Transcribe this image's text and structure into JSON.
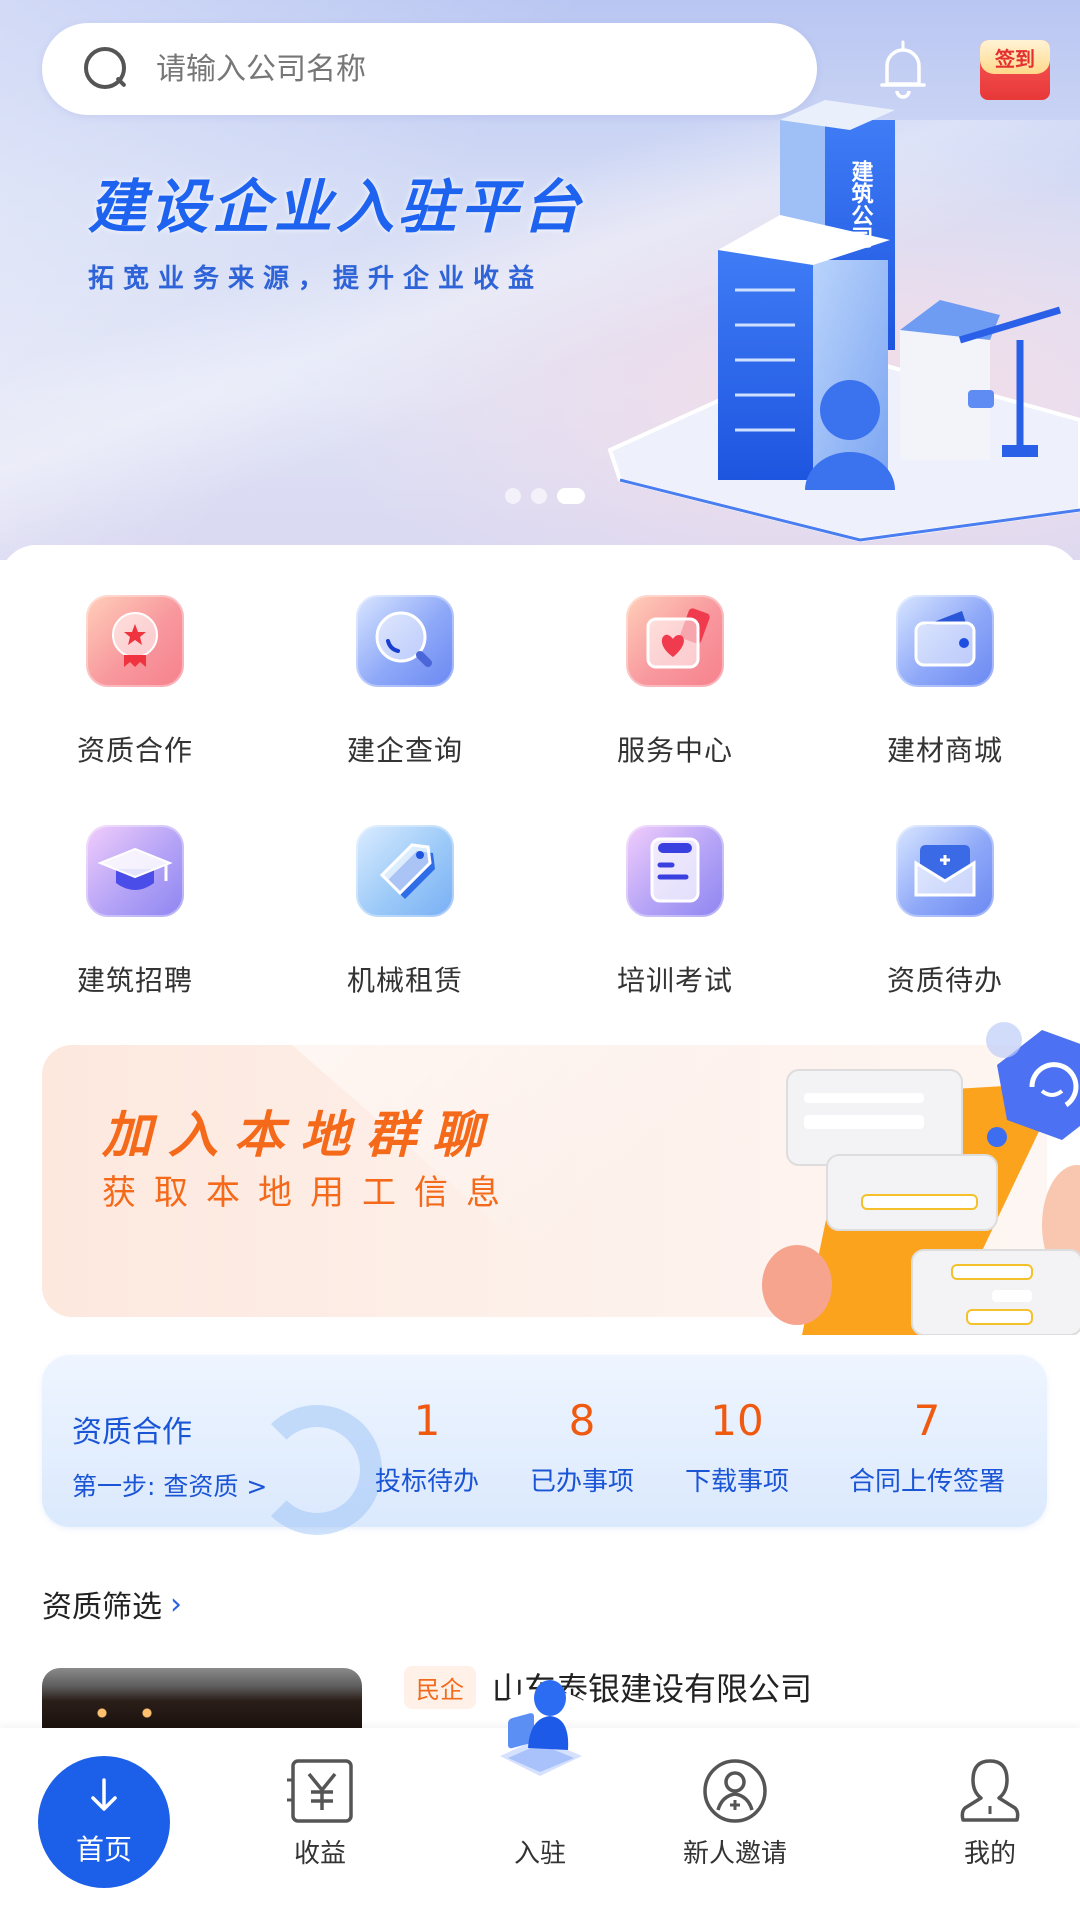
{
  "header": {
    "search_placeholder": "请输入公司名称",
    "notification_icon": "bell-icon",
    "checkin_label": "签到"
  },
  "banner": {
    "title": "建设企业入驻平台",
    "subtitle": "拓宽业务来源，提升企业收益",
    "building_sign": "建筑公司",
    "carousel": {
      "total": 3,
      "active_index": 2
    }
  },
  "grid": {
    "items": [
      {
        "label": "资质合作",
        "icon": "award-medal-icon",
        "theme": "red"
      },
      {
        "label": "建企查询",
        "icon": "magnifier-icon",
        "theme": "blue"
      },
      {
        "label": "服务中心",
        "icon": "heart-card-icon",
        "theme": "red"
      },
      {
        "label": "建材商城",
        "icon": "wallet-icon",
        "theme": "blue"
      },
      {
        "label": "建筑招聘",
        "icon": "graduation-cap-icon",
        "theme": "purple"
      },
      {
        "label": "机械租赁",
        "icon": "price-tag-icon",
        "theme": "sky"
      },
      {
        "label": "培训考试",
        "icon": "document-icon",
        "theme": "purple"
      },
      {
        "label": "资质待办",
        "icon": "envelope-plus-icon",
        "theme": "blue"
      }
    ]
  },
  "promo": {
    "title": "加入本地群聊",
    "subtitle": "获取本地用工信息"
  },
  "stats": {
    "title": "资质合作",
    "step_link": "第一步: 查资质 >",
    "items": [
      {
        "value": "1",
        "label": "投标待办"
      },
      {
        "value": "8",
        "label": "已办事项"
      },
      {
        "value": "10",
        "label": "下载事项"
      },
      {
        "value": "7",
        "label": "合同上传签署"
      }
    ]
  },
  "filter": {
    "heading": "资质筛选",
    "chevron": "›",
    "company": {
      "tag": "民企",
      "name": "山东泰银建设有限公司"
    }
  },
  "tabbar": {
    "items": [
      {
        "label": "首页",
        "icon": "arrow-down-icon",
        "active": true
      },
      {
        "label": "收益",
        "icon": "yen-book-icon",
        "active": false
      },
      {
        "label": "入驻",
        "icon": "enter-3d-icon",
        "active": false
      },
      {
        "label": "新人邀请",
        "icon": "invite-user-icon",
        "active": false
      },
      {
        "label": "我的",
        "icon": "user-icon",
        "active": false
      }
    ]
  },
  "colors": {
    "brand_blue": "#1C5FE8",
    "accent_orange": "#F05A10",
    "title_blue": "#1E63F0",
    "stats_text_blue": "#1A55D6"
  }
}
